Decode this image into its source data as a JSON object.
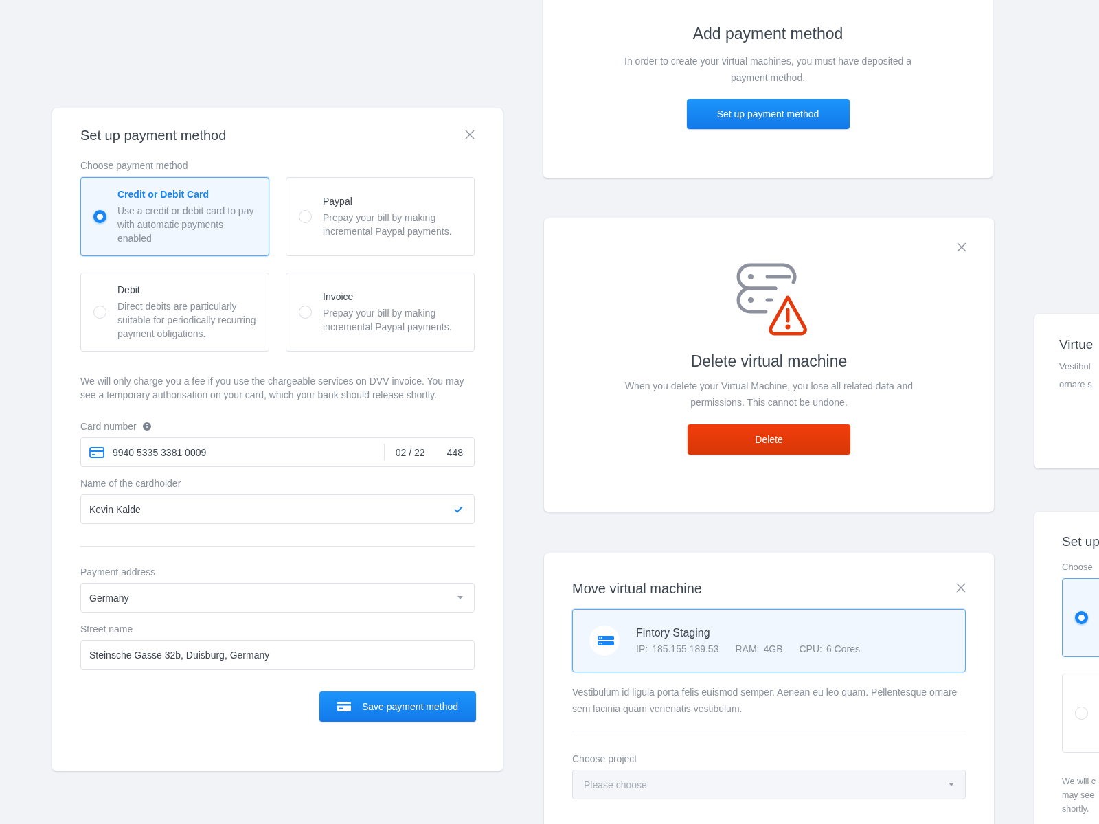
{
  "setup_payment": {
    "title": "Set up payment method",
    "section_label": "Choose payment method",
    "options": [
      {
        "title": "Credit or Debit Card",
        "description": "Use a credit or debit card to pay with automatic payments enabled",
        "selected": true
      },
      {
        "title": "Paypal",
        "description": "Prepay your bill by making incremental Paypal payments.",
        "selected": false
      },
      {
        "title": "Debit",
        "description": "Direct debits are particularly suitable for periodically recurring payment obligations.",
        "selected": false
      },
      {
        "title": "Invoice",
        "description": "Prepay your bill by making incremental Paypal payments.",
        "selected": false
      }
    ],
    "note": "We will only charge you a fee if you use the chargeable services on DVV invoice. You may see a temporary authorisation on your card, which your bank should release shortly.",
    "card_number": {
      "label": "Card number",
      "number": "9940 5335 3381 0009",
      "expiry": "02 / 22",
      "cvc": "448"
    },
    "cardholder": {
      "label": "Name of the cardholder",
      "value": "Kevin Kalde",
      "valid": true
    },
    "payment_address": {
      "label": "Payment address",
      "value": "Germany"
    },
    "street": {
      "label": "Street name",
      "value": "Steinsche Gasse 32b, Duisburg, Germany"
    },
    "save_button": "Save payment method"
  },
  "add_payment": {
    "title": "Add payment method",
    "description": "In order to create your virtual machines, you must have deposited a payment method.",
    "button": "Set up payment method"
  },
  "delete_vm": {
    "title": "Delete virtual machine",
    "description": "When you delete your Virtual Machine, you lose all related data and permissions. This cannot be undone.",
    "button": "Delete"
  },
  "move_vm": {
    "title": "Move virtual machine",
    "machine": {
      "name": "Fintory Staging",
      "ip_label": "IP:",
      "ip": "185.155.189.53",
      "ram_label": "RAM:",
      "ram": "4GB",
      "cpu_label": "CPU:",
      "cpu": "6 Cores",
      "selected": true
    },
    "description": "Vestibulum id ligula porta felis euismod semper. Aenean eu leo quam. Pellentesque ornare sem lacinia quam venenatis vestibulum.",
    "project": {
      "label": "Choose project",
      "placeholder": "Please choose"
    }
  },
  "virtual_card": {
    "title": "Virtue",
    "lines": [
      "Vestibul",
      "ornare s"
    ]
  },
  "setup_payment_partial": {
    "title": "Set up",
    "section_label": "Choose",
    "options": [
      {
        "selected": true
      },
      {
        "selected": false
      }
    ],
    "note_lines": [
      "We will c",
      "may see",
      "shortly."
    ]
  }
}
